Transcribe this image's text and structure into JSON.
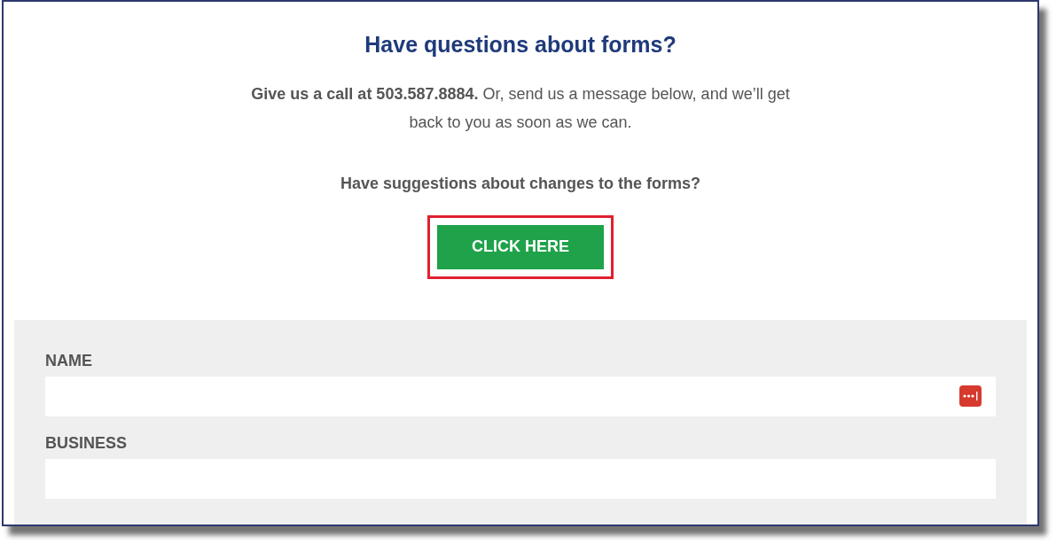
{
  "heading": "Have questions about forms?",
  "intro": "**Give us a call at 503.587.8884.** Or, send us a message below, and we’ll get back to you as soon as we can.",
  "suggestions": "Have suggestions about changes to the forms?",
  "button": {
    "label": "CLICK HERE",
    "highlighted": true
  },
  "form": {
    "fields": [
      {
        "label": "NAME",
        "autofill_icon": true
      },
      {
        "label": "BUSINESS",
        "autofill_icon": false
      }
    ]
  }
}
